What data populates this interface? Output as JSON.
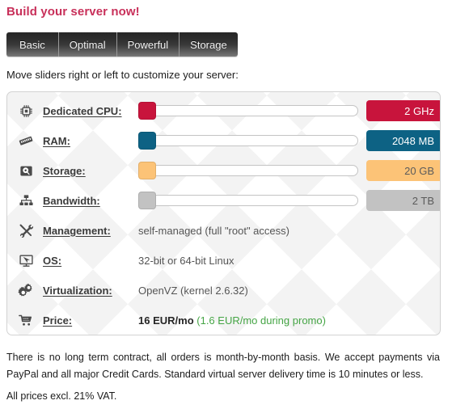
{
  "page_title": "Build your server now!",
  "title_color": "#c8305a",
  "tabs": [
    {
      "label": "Basic",
      "selected": true
    },
    {
      "label": "Optimal",
      "selected": false
    },
    {
      "label": "Powerful",
      "selected": false
    },
    {
      "label": "Storage",
      "selected": false
    }
  ],
  "instruction": "Move sliders right or left to customize your server:",
  "slider_rows": [
    {
      "icon": "cpu-chip-icon",
      "label": "Dedicated CPU:",
      "value": "2 GHz",
      "handle_percent": 0,
      "color": "#c8143c",
      "text_color": "#ffffff"
    },
    {
      "icon": "ram-stick-icon",
      "label": "RAM:",
      "value": "2048 MB",
      "handle_percent": 0,
      "color": "#0d6284",
      "text_color": "#ffffff"
    },
    {
      "icon": "hard-disk-icon",
      "label": "Storage:",
      "value": "20 GB",
      "handle_percent": 0,
      "color": "#fcc377",
      "text_color": "#5b5b5b"
    },
    {
      "icon": "network-tree-icon",
      "label": "Bandwidth:",
      "value": "2 TB",
      "handle_percent": 0,
      "color": "#c2c2c2",
      "text_color": "#5b5b5b"
    }
  ],
  "info_rows": [
    {
      "icon": "tools-icon",
      "label": "Management:",
      "value": "self-managed (full \"root\" access)"
    },
    {
      "icon": "monitor-icon",
      "label": "OS:",
      "value": "32-bit or 64-bit Linux"
    },
    {
      "icon": "gears-icon",
      "label": "Virtualization:",
      "value": "OpenVZ (kernel 2.6.32)"
    }
  ],
  "price_row": {
    "icon": "shopping-cart-icon",
    "label": "Price:",
    "amount": "16 EUR/mo",
    "promo": "(1.6 EUR/mo during promo)",
    "promo_color": "#45a545"
  },
  "footer": {
    "note": "There is no long term contract, all orders is month-by-month basis. We accept payments via PayPal and all major Credit Cards. Standard virtual server delivery time is 10 minutes or less.",
    "vat": "All prices excl. 21% VAT."
  }
}
